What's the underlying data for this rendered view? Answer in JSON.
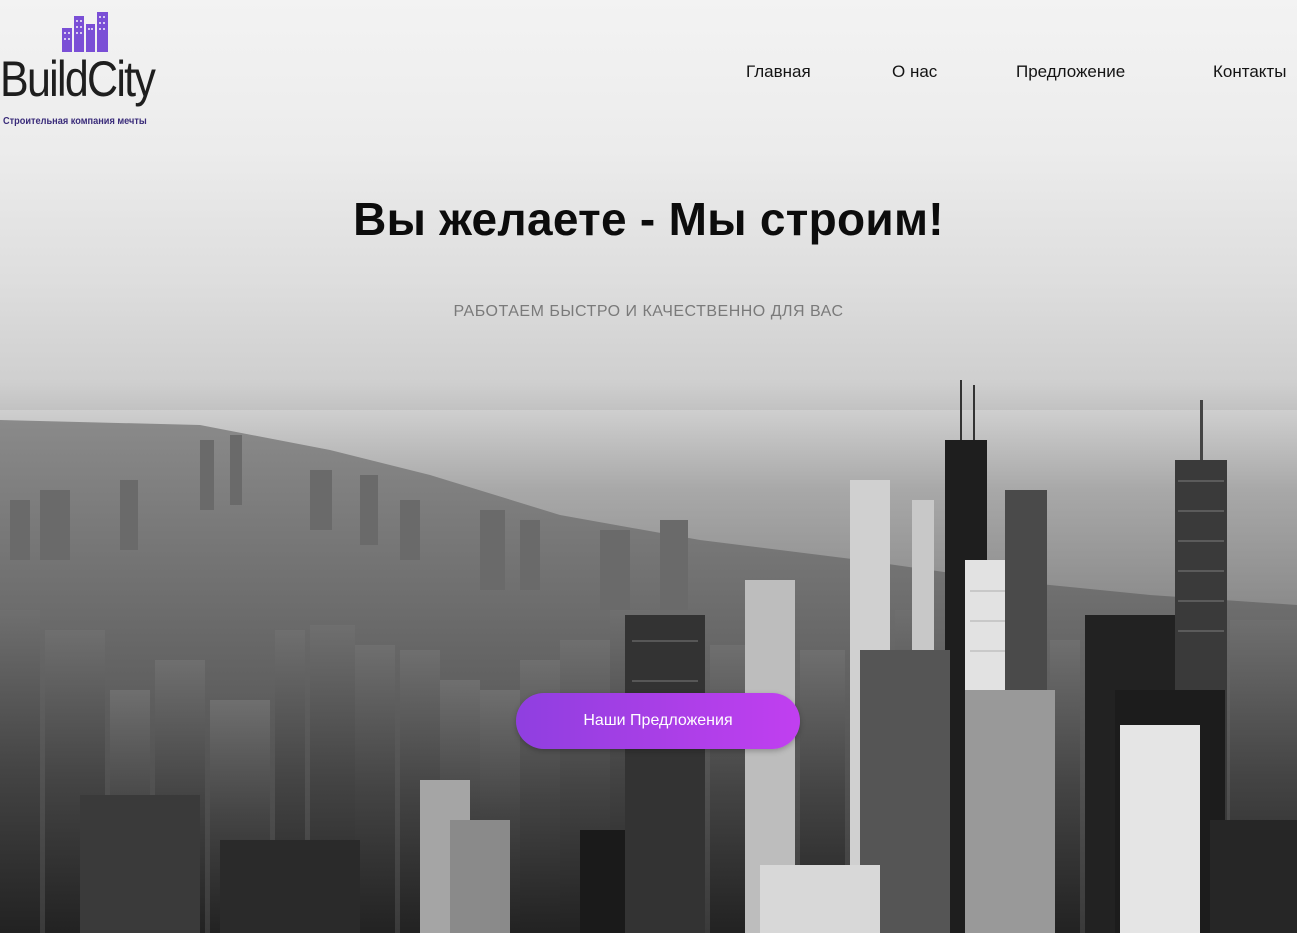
{
  "brand": {
    "name": "BuildCity",
    "tagline": "Строительная компания мечты",
    "accent_color": "#7a4fd6",
    "logo_icon": "buildings-icon"
  },
  "nav": {
    "items": [
      {
        "label": "Главная"
      },
      {
        "label": "О нас"
      },
      {
        "label": "Предложение"
      },
      {
        "label": "Контакты"
      }
    ]
  },
  "hero": {
    "title": "Вы желаете - Мы строим!",
    "subtitle": "РАБОТАЕМ БЫСТРО И КАЧЕСТВЕННО ДЛЯ ВАС",
    "cta_label": "Наши Предложения",
    "cta_color_start": "#8f3fe0",
    "cta_color_end": "#c13ff0",
    "background": "grayscale-city-skyline-photo"
  }
}
